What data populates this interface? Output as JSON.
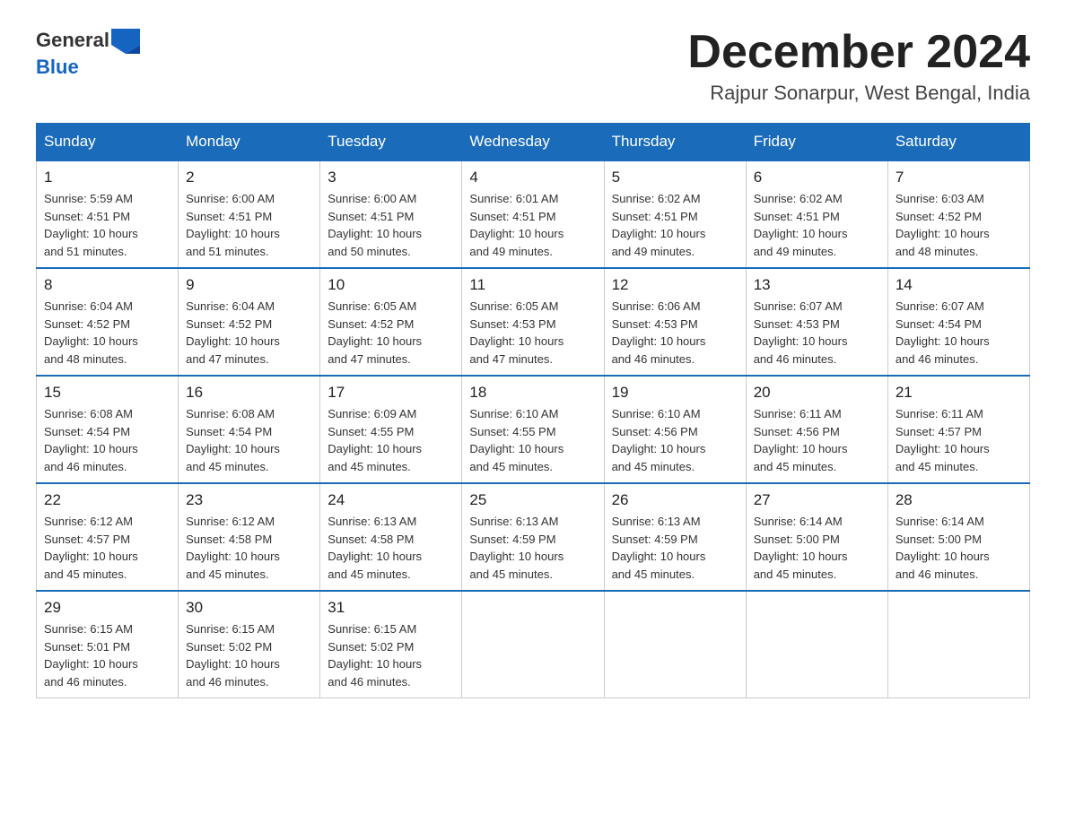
{
  "logo": {
    "text_black": "General",
    "text_blue": "Blue"
  },
  "title": "December 2024",
  "location": "Rajpur Sonarpur, West Bengal, India",
  "days_of_week": [
    "Sunday",
    "Monday",
    "Tuesday",
    "Wednesday",
    "Thursday",
    "Friday",
    "Saturday"
  ],
  "weeks": [
    [
      {
        "day": 1,
        "info": "Sunrise: 5:59 AM\nSunset: 4:51 PM\nDaylight: 10 hours\nand 51 minutes."
      },
      {
        "day": 2,
        "info": "Sunrise: 6:00 AM\nSunset: 4:51 PM\nDaylight: 10 hours\nand 51 minutes."
      },
      {
        "day": 3,
        "info": "Sunrise: 6:00 AM\nSunset: 4:51 PM\nDaylight: 10 hours\nand 50 minutes."
      },
      {
        "day": 4,
        "info": "Sunrise: 6:01 AM\nSunset: 4:51 PM\nDaylight: 10 hours\nand 49 minutes."
      },
      {
        "day": 5,
        "info": "Sunrise: 6:02 AM\nSunset: 4:51 PM\nDaylight: 10 hours\nand 49 minutes."
      },
      {
        "day": 6,
        "info": "Sunrise: 6:02 AM\nSunset: 4:51 PM\nDaylight: 10 hours\nand 49 minutes."
      },
      {
        "day": 7,
        "info": "Sunrise: 6:03 AM\nSunset: 4:52 PM\nDaylight: 10 hours\nand 48 minutes."
      }
    ],
    [
      {
        "day": 8,
        "info": "Sunrise: 6:04 AM\nSunset: 4:52 PM\nDaylight: 10 hours\nand 48 minutes."
      },
      {
        "day": 9,
        "info": "Sunrise: 6:04 AM\nSunset: 4:52 PM\nDaylight: 10 hours\nand 47 minutes."
      },
      {
        "day": 10,
        "info": "Sunrise: 6:05 AM\nSunset: 4:52 PM\nDaylight: 10 hours\nand 47 minutes."
      },
      {
        "day": 11,
        "info": "Sunrise: 6:05 AM\nSunset: 4:53 PM\nDaylight: 10 hours\nand 47 minutes."
      },
      {
        "day": 12,
        "info": "Sunrise: 6:06 AM\nSunset: 4:53 PM\nDaylight: 10 hours\nand 46 minutes."
      },
      {
        "day": 13,
        "info": "Sunrise: 6:07 AM\nSunset: 4:53 PM\nDaylight: 10 hours\nand 46 minutes."
      },
      {
        "day": 14,
        "info": "Sunrise: 6:07 AM\nSunset: 4:54 PM\nDaylight: 10 hours\nand 46 minutes."
      }
    ],
    [
      {
        "day": 15,
        "info": "Sunrise: 6:08 AM\nSunset: 4:54 PM\nDaylight: 10 hours\nand 46 minutes."
      },
      {
        "day": 16,
        "info": "Sunrise: 6:08 AM\nSunset: 4:54 PM\nDaylight: 10 hours\nand 45 minutes."
      },
      {
        "day": 17,
        "info": "Sunrise: 6:09 AM\nSunset: 4:55 PM\nDaylight: 10 hours\nand 45 minutes."
      },
      {
        "day": 18,
        "info": "Sunrise: 6:10 AM\nSunset: 4:55 PM\nDaylight: 10 hours\nand 45 minutes."
      },
      {
        "day": 19,
        "info": "Sunrise: 6:10 AM\nSunset: 4:56 PM\nDaylight: 10 hours\nand 45 minutes."
      },
      {
        "day": 20,
        "info": "Sunrise: 6:11 AM\nSunset: 4:56 PM\nDaylight: 10 hours\nand 45 minutes."
      },
      {
        "day": 21,
        "info": "Sunrise: 6:11 AM\nSunset: 4:57 PM\nDaylight: 10 hours\nand 45 minutes."
      }
    ],
    [
      {
        "day": 22,
        "info": "Sunrise: 6:12 AM\nSunset: 4:57 PM\nDaylight: 10 hours\nand 45 minutes."
      },
      {
        "day": 23,
        "info": "Sunrise: 6:12 AM\nSunset: 4:58 PM\nDaylight: 10 hours\nand 45 minutes."
      },
      {
        "day": 24,
        "info": "Sunrise: 6:13 AM\nSunset: 4:58 PM\nDaylight: 10 hours\nand 45 minutes."
      },
      {
        "day": 25,
        "info": "Sunrise: 6:13 AM\nSunset: 4:59 PM\nDaylight: 10 hours\nand 45 minutes."
      },
      {
        "day": 26,
        "info": "Sunrise: 6:13 AM\nSunset: 4:59 PM\nDaylight: 10 hours\nand 45 minutes."
      },
      {
        "day": 27,
        "info": "Sunrise: 6:14 AM\nSunset: 5:00 PM\nDaylight: 10 hours\nand 45 minutes."
      },
      {
        "day": 28,
        "info": "Sunrise: 6:14 AM\nSunset: 5:00 PM\nDaylight: 10 hours\nand 46 minutes."
      }
    ],
    [
      {
        "day": 29,
        "info": "Sunrise: 6:15 AM\nSunset: 5:01 PM\nDaylight: 10 hours\nand 46 minutes."
      },
      {
        "day": 30,
        "info": "Sunrise: 6:15 AM\nSunset: 5:02 PM\nDaylight: 10 hours\nand 46 minutes."
      },
      {
        "day": 31,
        "info": "Sunrise: 6:15 AM\nSunset: 5:02 PM\nDaylight: 10 hours\nand 46 minutes."
      },
      null,
      null,
      null,
      null
    ]
  ]
}
